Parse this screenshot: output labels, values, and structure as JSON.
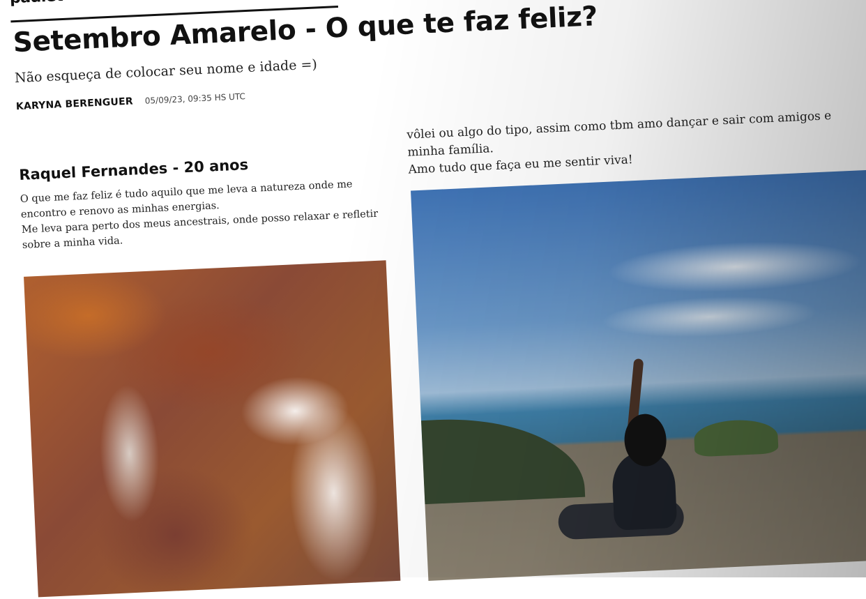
{
  "brand": {
    "logo_text": "padlet"
  },
  "board": {
    "title": "Setembro Amarelo - O que te faz feliz?",
    "description": "Não esqueça de colocar seu nome e idade =)",
    "author": "KARYNA BERENGUER",
    "date": "05/09/23, 09:35 HS UTC"
  },
  "posts": [
    {
      "title": "Raquel Fernandes - 20 anos",
      "paragraphs": [
        "O que me faz feliz é tudo aquilo que me leva a natureza onde me encontro e renovo as minhas energias.",
        "Me leva para perto dos meus ancestrais, onde posso relaxar e refletir sobre a minha vida."
      ]
    },
    {
      "paragraphs": [
        "vôlei ou algo do tipo, assim como tbm amo dançar e sair com amigos e minha família.",
        "Amo tudo que faça eu me sentir viva!"
      ]
    }
  ]
}
